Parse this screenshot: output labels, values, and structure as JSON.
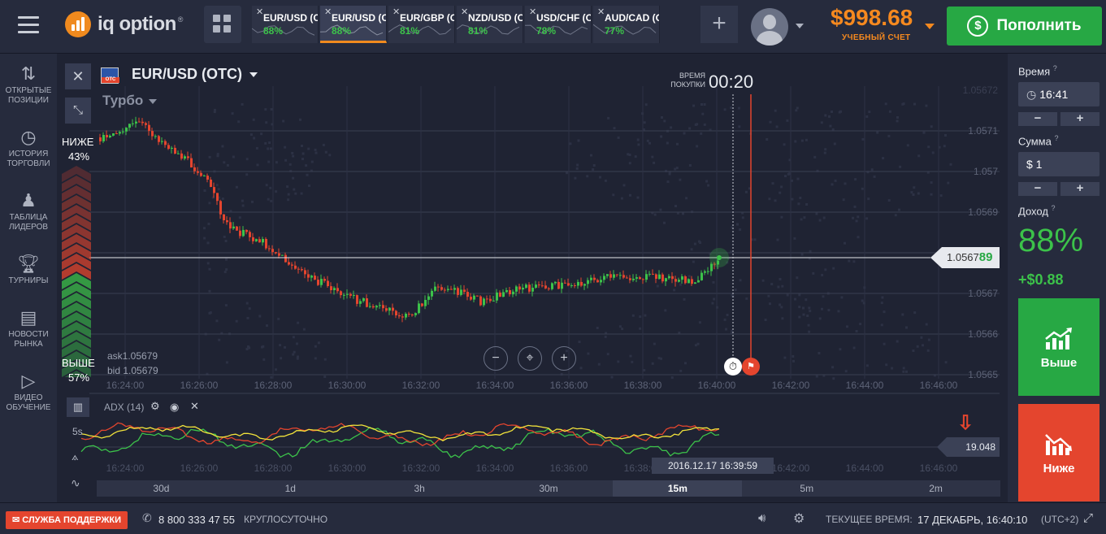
{
  "header": {
    "logo_text": "iq option",
    "logo_reg": "®",
    "balance": "$998.68",
    "account_type": "УЧЕБНЫЙ СЧЕТ",
    "deposit_label": "Пополнить",
    "add_tab_glyph": "+",
    "tabs": [
      {
        "name": "EUR/USD (OTC)",
        "percent": "88%"
      },
      {
        "name": "EUR/USD (OTC)",
        "percent": "88%"
      },
      {
        "name": "EUR/GBP (OTC)",
        "percent": "81%"
      },
      {
        "name": "NZD/USD (OTC)",
        "percent": "81%"
      },
      {
        "name": "USD/CHF (OTC)",
        "percent": "78%"
      },
      {
        "name": "AUD/CAD (OTC)",
        "percent": "77%"
      }
    ]
  },
  "sidebar": {
    "items": [
      {
        "label": "ОТКРЫТЫЕ ПОЗИЦИИ",
        "icon": "up-down-arrows-icon"
      },
      {
        "label": "ИСТОРИЯ ТОРГОВЛИ",
        "icon": "history-icon"
      },
      {
        "label": "ТАБЛИЦА ЛИДЕРОВ",
        "icon": "leaders-icon"
      },
      {
        "label": "ТУРНИРЫ",
        "icon": "trophy-icon"
      },
      {
        "label": "НОВОСТИ РЫНКА",
        "icon": "news-icon"
      },
      {
        "label": "ВИДЕО ОБУЧЕНИЕ",
        "icon": "video-icon"
      }
    ]
  },
  "chart": {
    "asset": "EUR/USD (OTC)",
    "mode": "Турбо",
    "purchase_time_label_1": "ВРЕМЯ",
    "purchase_time_label_2": "ПОКУПКИ",
    "purchase_time": "00:20",
    "lower_label": "НИЖЕ",
    "lower_pct": "43%",
    "higher_label": "ВЫШЕ",
    "higher_pct": "57%",
    "ask": "ask1.05679",
    "bid": "bid 1.05679",
    "current_price_main": "1.0567",
    "current_price_tail": "89",
    "price_ticks": [
      "1.05672",
      "1.0571",
      "1.057",
      "1.0569",
      "1.0568",
      "1.0567",
      "1.0566",
      "1.0565"
    ],
    "time_ticks": [
      "16:24:00",
      "16:26:00",
      "16:28:00",
      "16:30:00",
      "16:32:00",
      "16:34:00",
      "16:36:00",
      "16:38:00",
      "16:40:00",
      "16:42:00",
      "16:44:00",
      "16:46:00"
    ],
    "indicator_label": "ADX (14)",
    "indicator_value": "19.048",
    "timeframe_tag": "5s",
    "crosshair_time": "2016.12.17 16:39:59",
    "zoom_out": "−",
    "zoom_in": "+",
    "periods": [
      "30d",
      "1d",
      "3h",
      "30m",
      "15m",
      "5m",
      "2m"
    ],
    "active_period": "15m",
    "colors": {
      "up": "#3cc24a",
      "down": "#e4452e",
      "adx": "#f2e33b",
      "plus_di": "#3cc24a",
      "minus_di": "#e4452e"
    }
  },
  "panel": {
    "time_label": "Время",
    "time_value": "16:41",
    "amount_label": "Сумма",
    "amount_value": "$ 1",
    "minus": "−",
    "plus": "+",
    "income_label": "Доход",
    "income_pct": "88%",
    "income_abs": "+$0.88",
    "higher_btn": "Выше",
    "lower_btn": "Ниже",
    "info_mark": "?"
  },
  "footer": {
    "support": "СЛУЖБА ПОДДЕРЖКИ",
    "phone": "8 800 333 47 55",
    "hours": "КРУГЛОСУТОЧНО",
    "time_label": "ТЕКУЩЕЕ ВРЕМЯ:",
    "time_value": "17 ДЕКАБРЬ, 16:40:10",
    "tz": "(UTC+2)"
  }
}
